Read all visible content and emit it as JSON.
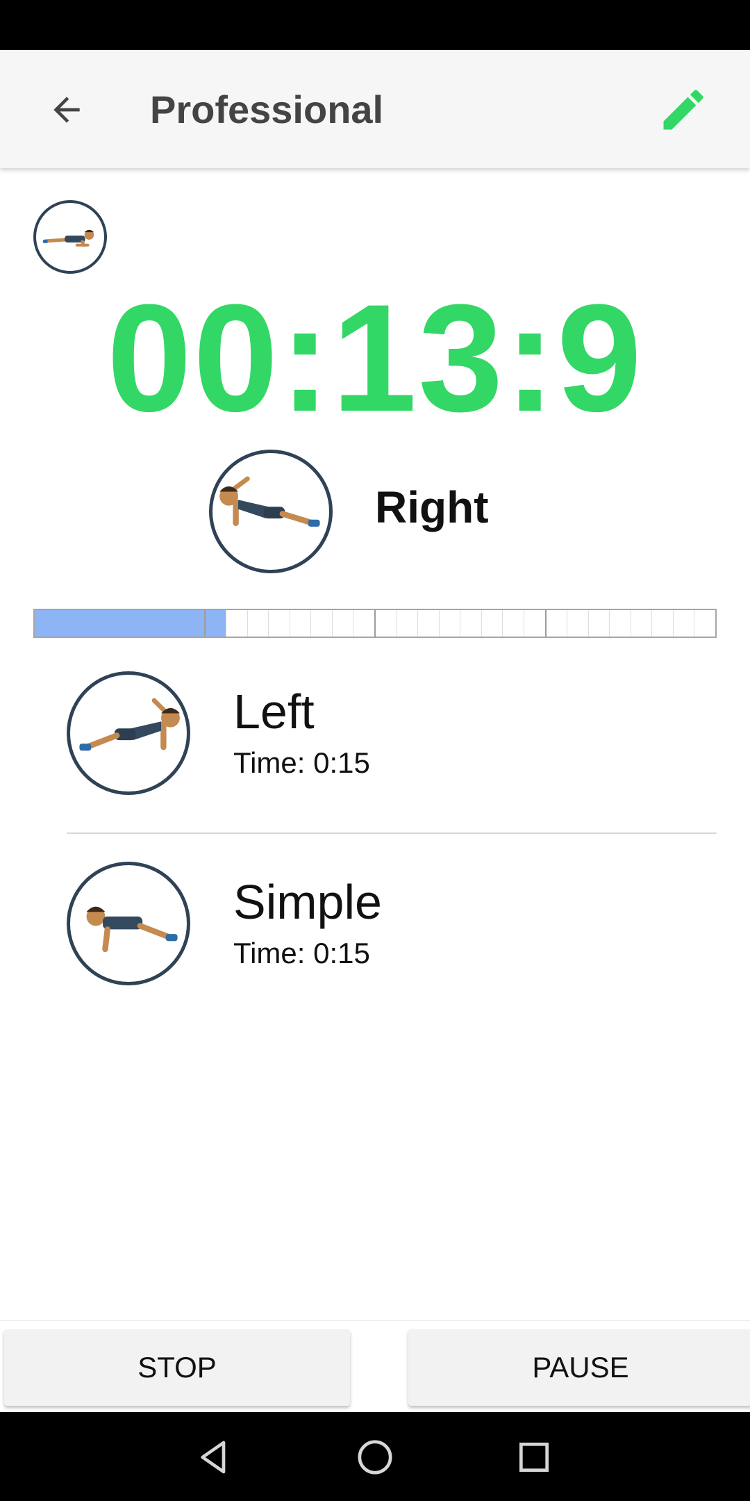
{
  "header": {
    "title": "Professional",
    "back_icon": "arrow-back-icon",
    "edit_icon": "pencil-icon",
    "accent_color": "#33d765"
  },
  "current": {
    "timer": "00:13:9",
    "label": "Right",
    "progress_fraction": 0.26
  },
  "upcoming": [
    {
      "name": "Left",
      "time": "Time: 0:15"
    },
    {
      "name": "Simple",
      "time": "Time: 0:15"
    }
  ],
  "controls": {
    "stop_label": "STOP",
    "pause_label": "PAUSE"
  },
  "system_nav": {
    "back": "triangle-back-icon",
    "home": "circle-home-icon",
    "recents": "square-recents-icon"
  }
}
